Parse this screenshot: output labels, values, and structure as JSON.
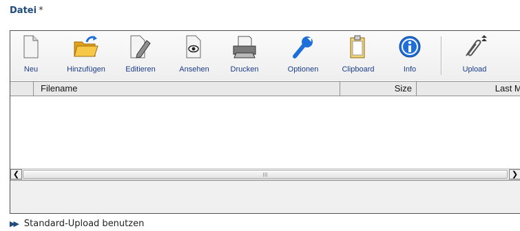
{
  "field": {
    "label": "Datei",
    "required_marker": "*"
  },
  "toolbar": {
    "buttons": [
      {
        "label": "Neu",
        "icon": "new-document-icon"
      },
      {
        "label": "Hinzufügen",
        "icon": "open-folder-icon"
      },
      {
        "label": "Editieren",
        "icon": "edit-document-icon"
      },
      {
        "label": "Ansehen",
        "icon": "view-document-icon"
      },
      {
        "label": "Drucken",
        "icon": "printer-icon"
      },
      {
        "label": "Optionen",
        "icon": "wrench-icon"
      },
      {
        "label": "Clipboard",
        "icon": "clipboard-icon"
      },
      {
        "label": "Info",
        "icon": "info-icon"
      },
      {
        "label": "Upload",
        "icon": "paperclip-upload-icon"
      }
    ]
  },
  "table": {
    "columns": [
      "Filename",
      "Size",
      "Last Mo"
    ],
    "rows": []
  },
  "scrollbar": {
    "grip": "III"
  },
  "footer": {
    "link_label": "Standard-Upload benutzen",
    "link_icon": "double-arrow-icon"
  },
  "colors": {
    "label": "#1f4b7c",
    "toolbar_text": "#1a3c8c",
    "icon_blue": "#1e6fd9",
    "folder": "#f2b632"
  }
}
